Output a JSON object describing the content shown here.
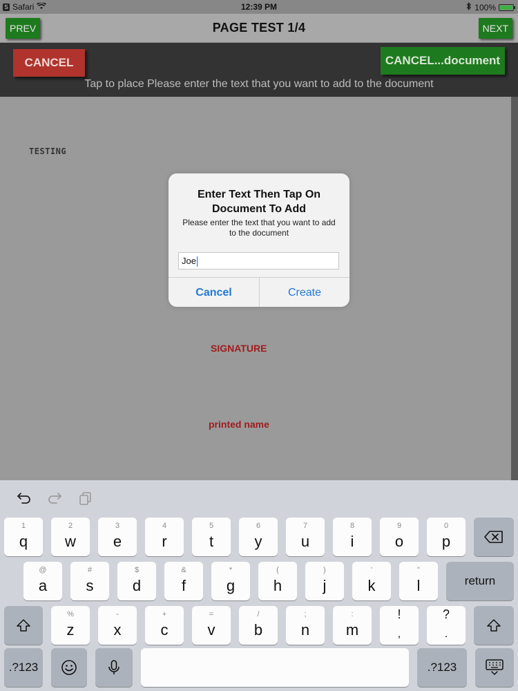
{
  "status_bar": {
    "back_app": "Safari",
    "back_badge": "S",
    "time": "12:39 PM",
    "battery": "100%",
    "battery_level": 1.0,
    "icons": [
      "wifi-icon",
      "bluetooth-icon",
      "battery-icon"
    ]
  },
  "nav": {
    "prev_label": "PREV",
    "title": "PAGE TEST 1/4",
    "next_label": "NEXT"
  },
  "toolbar": {
    "cancel_label": "CANCEL",
    "cancel_document_label": "CANCEL...document",
    "hint": "Tap to place Please enter the text that you want to add to the document"
  },
  "document": {
    "testing_label": "TESTING",
    "signature_label": "SIGNATURE",
    "printed_name_label": "printed name"
  },
  "dialog": {
    "title": "Enter Text Then Tap On Document To Add",
    "message": "Please enter the text that you want to add to the document",
    "input_value": "Joe",
    "cancel_label": "Cancel",
    "create_label": "Create"
  },
  "keyboard": {
    "tools": [
      "undo-icon",
      "redo-icon",
      "paste-icon"
    ],
    "row1": [
      {
        "hint": "1",
        "key": "q"
      },
      {
        "hint": "2",
        "key": "w"
      },
      {
        "hint": "3",
        "key": "e"
      },
      {
        "hint": "4",
        "key": "r"
      },
      {
        "hint": "5",
        "key": "t"
      },
      {
        "hint": "6",
        "key": "y"
      },
      {
        "hint": "7",
        "key": "u"
      },
      {
        "hint": "8",
        "key": "i"
      },
      {
        "hint": "9",
        "key": "o"
      },
      {
        "hint": "0",
        "key": "p"
      }
    ],
    "row2": [
      {
        "hint": "@",
        "key": "a"
      },
      {
        "hint": "#",
        "key": "s"
      },
      {
        "hint": "$",
        "key": "d"
      },
      {
        "hint": "&",
        "key": "f"
      },
      {
        "hint": "*",
        "key": "g"
      },
      {
        "hint": "(",
        "key": "h"
      },
      {
        "hint": ")",
        "key": "j"
      },
      {
        "hint": "'",
        "key": "k"
      },
      {
        "hint": "\"",
        "key": "l"
      }
    ],
    "return_label": "return",
    "row3": [
      {
        "hint": "%",
        "key": "z"
      },
      {
        "hint": "-",
        "key": "x"
      },
      {
        "hint": "+",
        "key": "c"
      },
      {
        "hint": "=",
        "key": "v"
      },
      {
        "hint": "/",
        "key": "b"
      },
      {
        "hint": ";",
        "key": "n"
      },
      {
        "hint": ":",
        "key": "m"
      },
      {
        "hint": "!",
        "key": ","
      },
      {
        "hint": "?",
        "key": "."
      }
    ],
    "numbers_label": ".?123",
    "numbers_label_right": ".?123"
  }
}
